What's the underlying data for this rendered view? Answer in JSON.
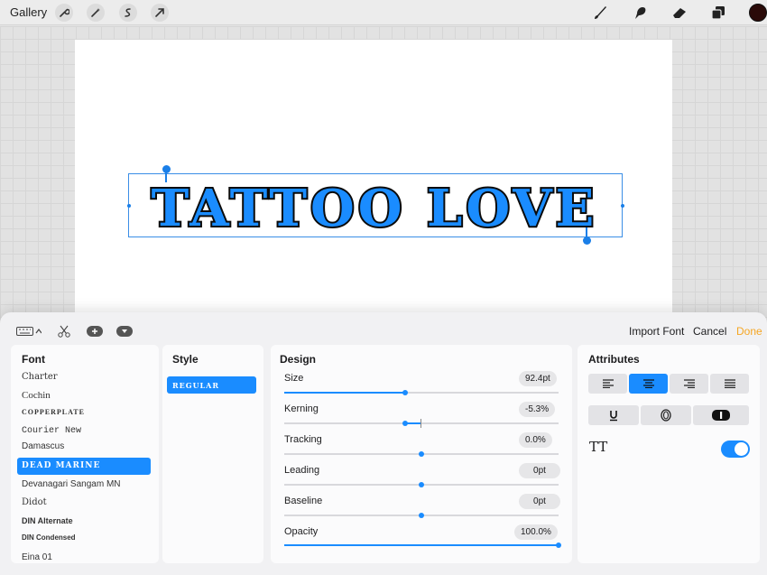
{
  "topbar": {
    "gallery_label": "Gallery",
    "left_tools": [
      "wrench-icon",
      "magic-wand-icon",
      "selection-icon",
      "transform-arrow-icon"
    ],
    "right_tools": [
      "brush-icon",
      "smudge-icon",
      "eraser-icon",
      "layers-icon"
    ],
    "current_color": "#2a0a08"
  },
  "canvas": {
    "text_layer": "TATTOO LOVE",
    "text_fill": "#1a8cff",
    "text_stroke": "#0b0b0b"
  },
  "panel": {
    "import_font_label": "Import Font",
    "cancel_label": "Cancel",
    "done_label": "Done",
    "font": {
      "header": "Font",
      "items": [
        "Charter",
        "Cochin",
        "COPPERPLATE",
        "Courier New",
        "Damascus",
        "DEAD MARINE",
        "Devanagari Sangam MN",
        "Didot",
        "DIN Alternate",
        "DIN Condensed",
        "Eina 01"
      ],
      "selected": "DEAD MARINE"
    },
    "style": {
      "header": "Style",
      "selected": "REGULAR"
    },
    "design": {
      "header": "Design",
      "size_label": "Size",
      "size_value": "92.4pt",
      "size_level": 0.44,
      "kerning_label": "Kerning",
      "kerning_value": "-5.3%",
      "kerning_level": 0.44,
      "tracking_label": "Tracking",
      "tracking_value": "0.0%",
      "tracking_level": 0.5,
      "leading_label": "Leading",
      "leading_value": "0pt",
      "leading_level": 0.5,
      "baseline_label": "Baseline",
      "baseline_value": "0pt",
      "baseline_level": 0.5,
      "opacity_label": "Opacity",
      "opacity_value": "100.0%",
      "opacity_level": 1.0
    },
    "attributes": {
      "header": "Attributes",
      "alignment_selected": "center",
      "tt_label": "TT",
      "all_caps_enabled": true,
      "accent": "#1a8cff"
    }
  }
}
